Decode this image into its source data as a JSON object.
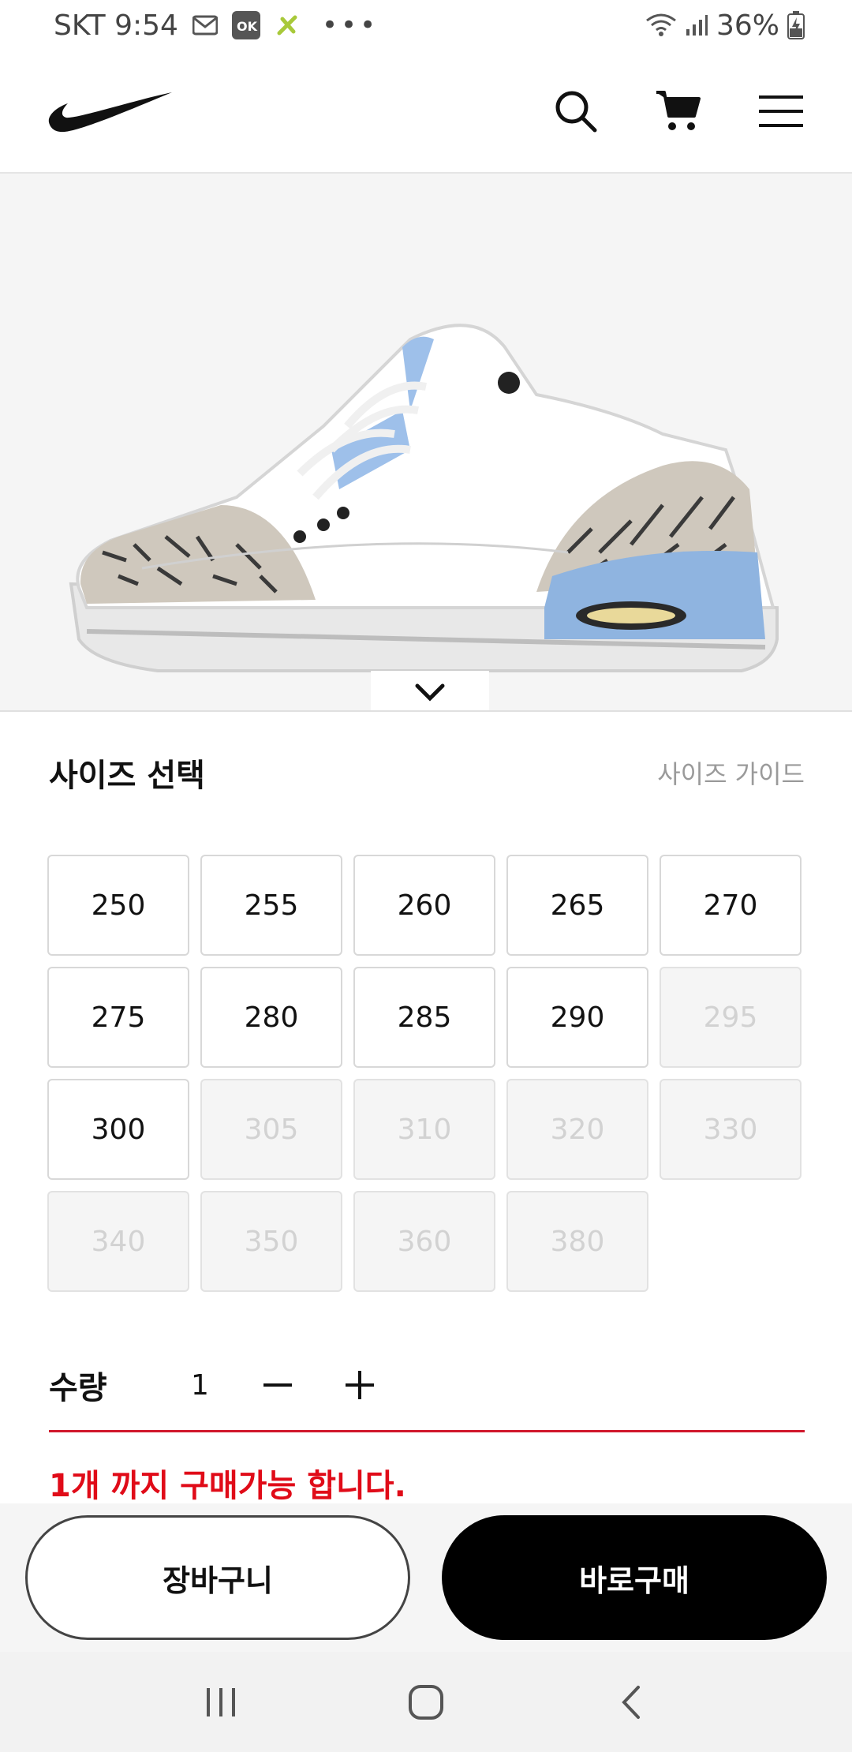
{
  "status_bar": {
    "carrier_time": "SKT 9:54",
    "battery": "36%",
    "icons": [
      "gmail-icon",
      "ok-icon",
      "app-icon",
      "more-dots-icon",
      "wifi-icon",
      "signal-icon",
      "battery-charging-icon"
    ]
  },
  "header": {
    "logo": "nike-swoosh-logo",
    "icons": [
      "search-icon",
      "cart-icon",
      "menu-icon"
    ]
  },
  "size_section": {
    "title": "사이즈 선택",
    "guide_link": "사이즈 가이드",
    "sizes": [
      {
        "label": "250",
        "available": true
      },
      {
        "label": "255",
        "available": true
      },
      {
        "label": "260",
        "available": true
      },
      {
        "label": "265",
        "available": true
      },
      {
        "label": "270",
        "available": true
      },
      {
        "label": "275",
        "available": true
      },
      {
        "label": "280",
        "available": true
      },
      {
        "label": "285",
        "available": true
      },
      {
        "label": "290",
        "available": true
      },
      {
        "label": "295",
        "available": false
      },
      {
        "label": "300",
        "available": true
      },
      {
        "label": "305",
        "available": false
      },
      {
        "label": "310",
        "available": false
      },
      {
        "label": "320",
        "available": false
      },
      {
        "label": "330",
        "available": false
      },
      {
        "label": "340",
        "available": false
      },
      {
        "label": "350",
        "available": false
      },
      {
        "label": "360",
        "available": false
      },
      {
        "label": "380",
        "available": false
      }
    ]
  },
  "quantity": {
    "label": "수량",
    "value": "1",
    "limit_message": "1개 까지 구매가능 합니다."
  },
  "actions": {
    "cart_label": "장바구니",
    "buy_label": "바로구매"
  },
  "colors": {
    "accent_red": "#e00b18",
    "buy_button": "#000000",
    "disabled_text": "#d2d2d2"
  },
  "nav_bar": {
    "icons": [
      "recent-apps-icon",
      "home-icon",
      "back-icon"
    ]
  }
}
